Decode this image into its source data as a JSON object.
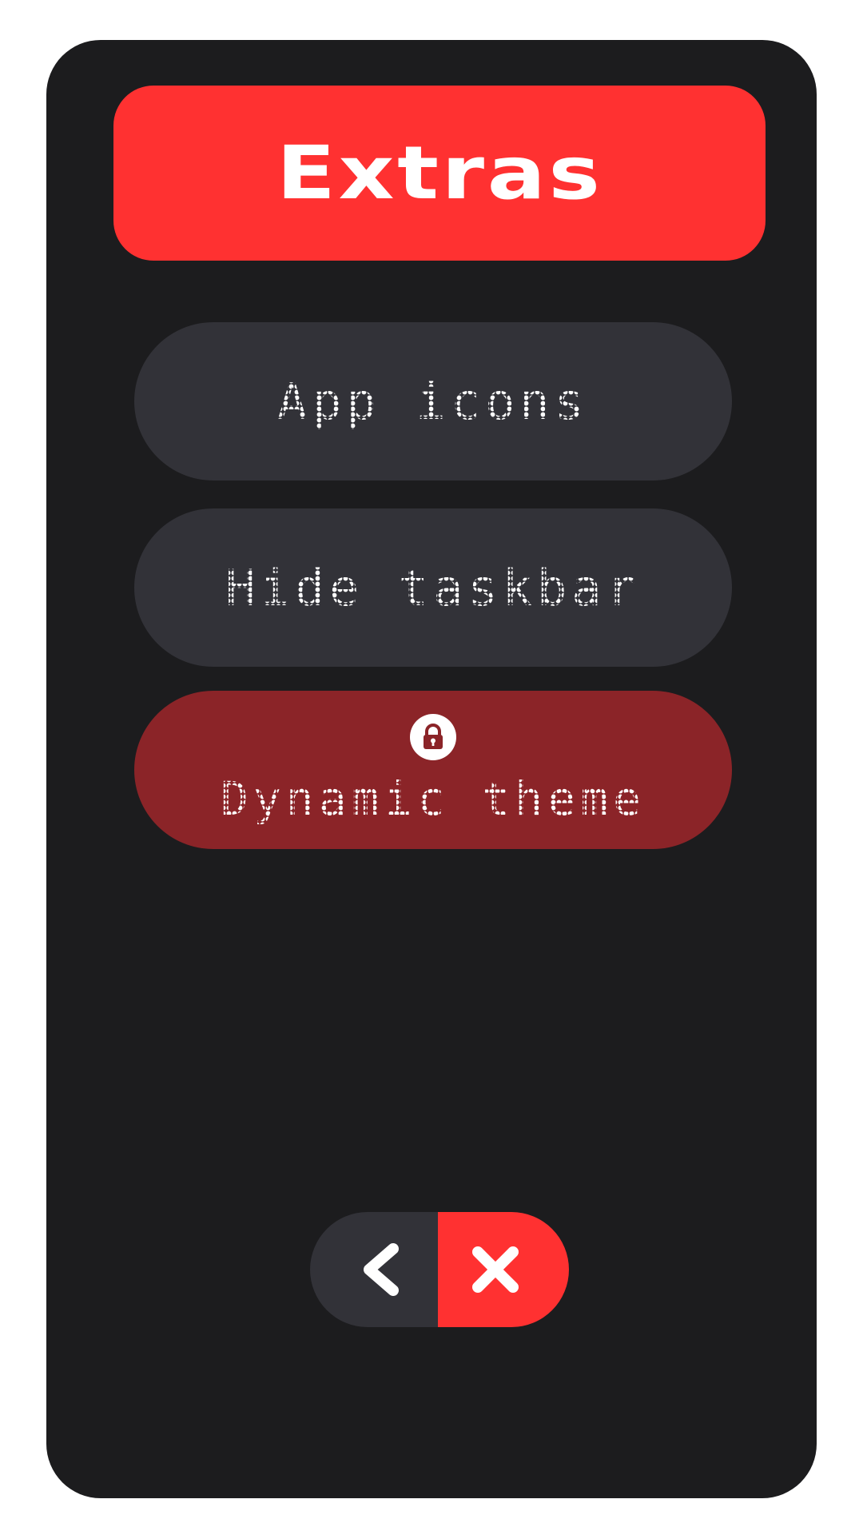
{
  "header": {
    "title": "Extras"
  },
  "menu": {
    "items": [
      {
        "label": "App icons"
      },
      {
        "label": "Hide taskbar"
      },
      {
        "label": "Dynamic theme",
        "locked": true
      }
    ]
  },
  "nav": {
    "back_icon": "chevron-left-icon",
    "close_icon": "close-icon"
  },
  "colors": {
    "background": "#1c1c1e",
    "accent": "#ff3131",
    "button": "#323238",
    "locked_button": "#8b2428",
    "text": "#ffffff"
  }
}
